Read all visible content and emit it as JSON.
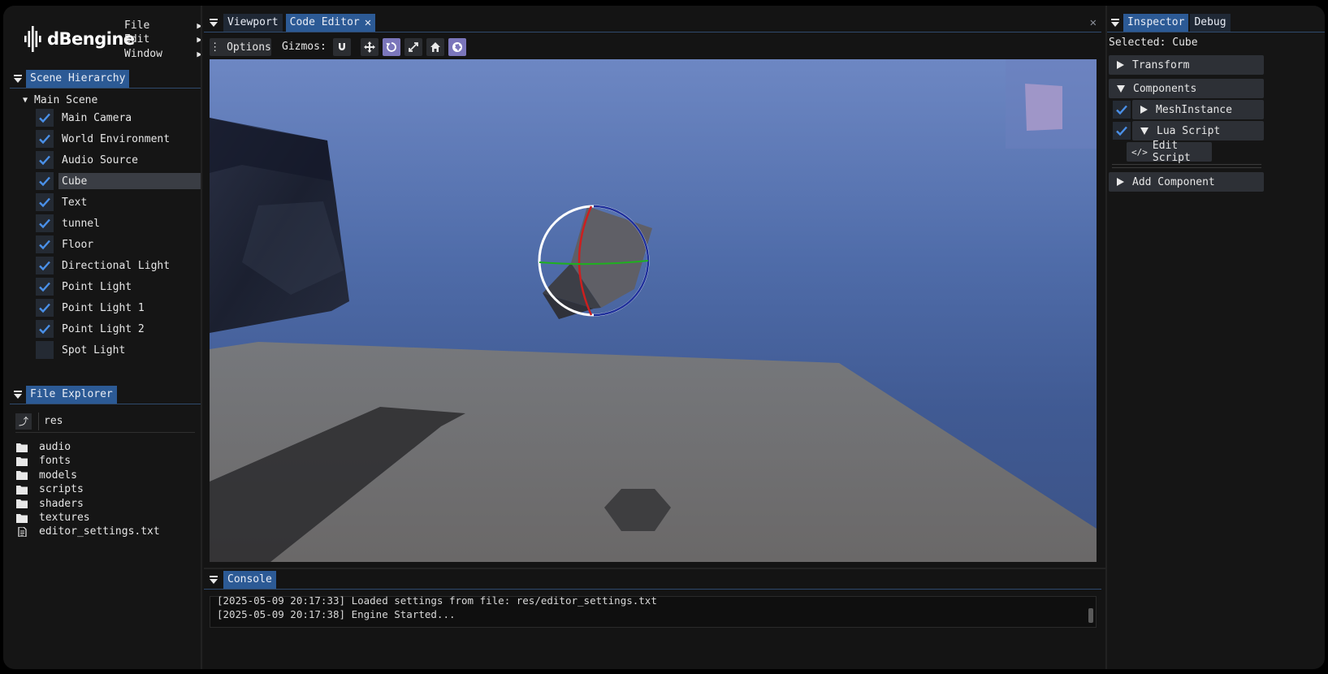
{
  "app": {
    "logo_text": "dBengine"
  },
  "menu": [
    {
      "label": "File"
    },
    {
      "label": "Edit"
    },
    {
      "label": "Window"
    }
  ],
  "scene_hierarchy": {
    "tab": "Scene Hierarchy",
    "root": "Main Scene",
    "items": [
      {
        "label": "Main Camera",
        "checked": true
      },
      {
        "label": "World Environment",
        "checked": true
      },
      {
        "label": "Audio Source",
        "checked": true
      },
      {
        "label": "Cube",
        "checked": true,
        "selected": true
      },
      {
        "label": "Text",
        "checked": true
      },
      {
        "label": "tunnel",
        "checked": true
      },
      {
        "label": "Floor",
        "checked": true
      },
      {
        "label": "Directional Light",
        "checked": true
      },
      {
        "label": "Point Light",
        "checked": true
      },
      {
        "label": "Point Light 1",
        "checked": true
      },
      {
        "label": "Point Light 2",
        "checked": true
      },
      {
        "label": "Spot Light",
        "checked": false
      }
    ]
  },
  "file_explorer": {
    "tab": "File Explorer",
    "path": "res",
    "folders": [
      "audio",
      "fonts",
      "models",
      "scripts",
      "shaders",
      "textures"
    ],
    "files": [
      "editor_settings.txt"
    ]
  },
  "center": {
    "tabs": [
      {
        "label": "Viewport"
      },
      {
        "label": "Code Editor"
      }
    ],
    "options_label": "Options",
    "gizmos_label": "Gizmos:"
  },
  "console": {
    "tab": "Console",
    "lines": [
      "[2025-05-09 20:17:33] Loaded settings from file: res/editor_settings.txt",
      "[2025-05-09 20:17:38] Engine Started..."
    ]
  },
  "inspector": {
    "tabs": [
      {
        "label": "Inspector"
      },
      {
        "label": "Debug"
      }
    ],
    "selected_text": "Selected: Cube",
    "transform_label": "Transform",
    "components_label": "Components",
    "mesh_instance_label": "MeshInstance",
    "lua_script_label": "Lua Script",
    "edit_script_label": "Edit Script",
    "add_component_label": "Add Component"
  },
  "colors": {
    "accent_blue": "#2c5a95",
    "check_blue": "#4a90e8",
    "gizmo_active": "#7b76bb"
  }
}
